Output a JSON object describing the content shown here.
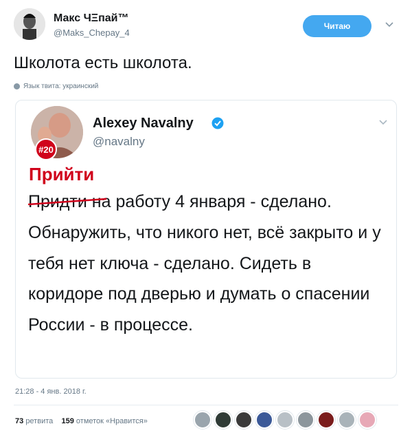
{
  "author": {
    "name": "Макс ЧΞпай™",
    "handle": "@Maks_Chepay_4",
    "follow_label": "Читаю",
    "text": "Школота есть школота.",
    "lang_note": "Язык твита: украинский"
  },
  "quoted": {
    "name": "Alexey Navalny",
    "handle": "@navalny",
    "badge": "#20",
    "correction": "Прийти",
    "struck_word": "Придти",
    "body_rest": " на работу 4 января - сделано. Обнаружить, что никого нет, всё закрыто и у тебя нет ключа - сделано. Сидеть в коридоре под дверью и думать о спасении России - в процессе."
  },
  "meta": {
    "timestamp": "21:28 - 4 янв. 2018 г.",
    "retweets_count": "73",
    "retweets_label": "ретвита",
    "likes_count": "159",
    "likes_label": "отметок «Нравится»"
  },
  "colors": {
    "accent": "#44a8f0",
    "correction_red": "#d0021b",
    "verified_blue": "#1da1f2"
  },
  "likers": [
    {
      "icon": "avatar-gray",
      "color": "#9aa5ad"
    },
    {
      "icon": "avatar-dark",
      "color": "#2f3b36"
    },
    {
      "icon": "avatar-skull",
      "color": "#3a3a3a"
    },
    {
      "icon": "avatar-fish",
      "color": "#3b5998"
    },
    {
      "icon": "avatar-silver",
      "color": "#b8c0c6"
    },
    {
      "icon": "avatar-gray2",
      "color": "#8c969c"
    },
    {
      "icon": "avatar-red",
      "color": "#7a1c1c"
    },
    {
      "icon": "avatar-light",
      "color": "#a9b3b9"
    },
    {
      "icon": "avatar-pink",
      "color": "#e7a8b6"
    }
  ]
}
